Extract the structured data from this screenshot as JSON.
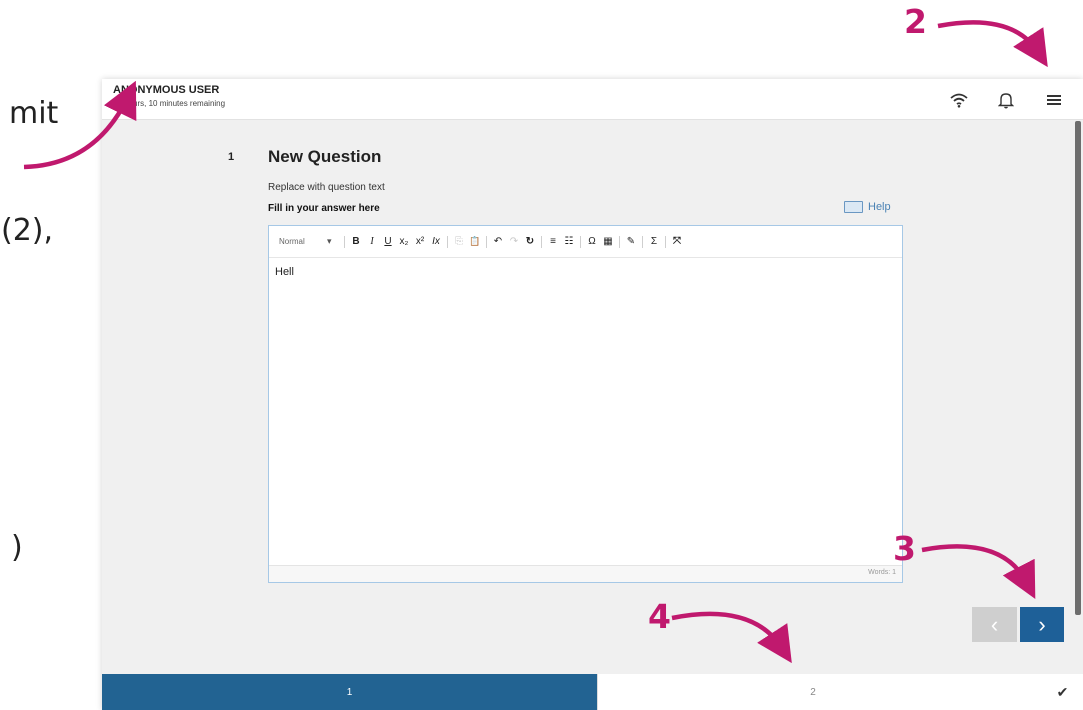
{
  "slide": {
    "fragments": [
      "mit",
      "(2),",
      ")"
    ]
  },
  "header": {
    "user_name": "ANONYMOUS USER",
    "time_remaining": "21 hours, 10 minutes remaining",
    "icons": [
      "wifi-icon",
      "bell-icon",
      "menu-icon"
    ]
  },
  "question": {
    "number": "1",
    "title": "New Question",
    "text": "Replace with question text",
    "answer_label": "Fill in your answer here",
    "help_label": "Help"
  },
  "editor": {
    "format_value": "Normal",
    "content": "Hell",
    "word_count": "Words: 1",
    "toolbar": [
      {
        "name": "bold-button",
        "glyph": "B"
      },
      {
        "name": "italic-button",
        "glyph": "I"
      },
      {
        "name": "underline-button",
        "glyph": "U"
      },
      {
        "name": "subscript-button",
        "glyph": "x₂"
      },
      {
        "name": "superscript-button",
        "glyph": "x²"
      },
      {
        "name": "remove-format-button",
        "glyph": "Ix"
      },
      {
        "name": "copy-button",
        "glyph": "⎘"
      },
      {
        "name": "paste-button",
        "glyph": "📋"
      },
      {
        "name": "undo-button",
        "glyph": "↶"
      },
      {
        "name": "redo-button",
        "glyph": "↷"
      },
      {
        "name": "spellcheck-button",
        "glyph": "↻"
      },
      {
        "name": "numbered-list-button",
        "glyph": "≡"
      },
      {
        "name": "bulleted-list-button",
        "glyph": "☷"
      },
      {
        "name": "special-char-button",
        "glyph": "Ω"
      },
      {
        "name": "table-button",
        "glyph": "▦"
      },
      {
        "name": "draw-button",
        "glyph": "✎"
      },
      {
        "name": "math-button",
        "glyph": "Σ"
      },
      {
        "name": "fullscreen-button",
        "glyph": "⤧"
      }
    ]
  },
  "navigation": {
    "prev_label": "‹",
    "next_label": "›",
    "pages": [
      "1",
      "2"
    ],
    "submit_glyph": "✔"
  },
  "annotations": [
    "2",
    "3",
    "4"
  ],
  "colors": {
    "primary": "#226392",
    "annotation": "#c0196e"
  }
}
